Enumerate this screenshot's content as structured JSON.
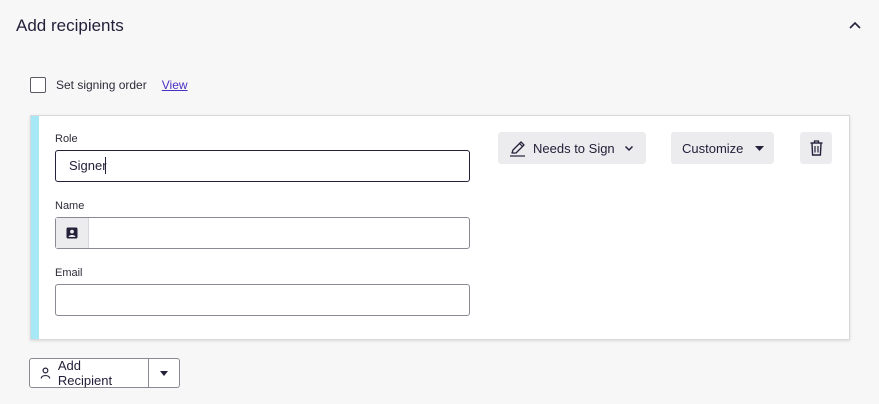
{
  "section": {
    "title": "Add recipients"
  },
  "signing_order": {
    "label": "Set signing order",
    "view_link": "View",
    "checked": false
  },
  "recipient": {
    "role_label": "Role",
    "role_value": "Signer",
    "name_label": "Name",
    "name_value": "",
    "email_label": "Email",
    "email_value": "",
    "action_label": "Needs to Sign",
    "customize_label": "Customize"
  },
  "footer": {
    "add_recipient_label": "Add Recipient"
  },
  "colors": {
    "accent_bar": "#a6e8f5",
    "link": "#4b2fc2",
    "text_dark": "#24203a"
  },
  "icons": [
    "chevron-up-icon",
    "pen-icon",
    "chevron-down-icon",
    "caret-down-icon",
    "trash-icon",
    "contact-card-icon",
    "person-icon"
  ]
}
